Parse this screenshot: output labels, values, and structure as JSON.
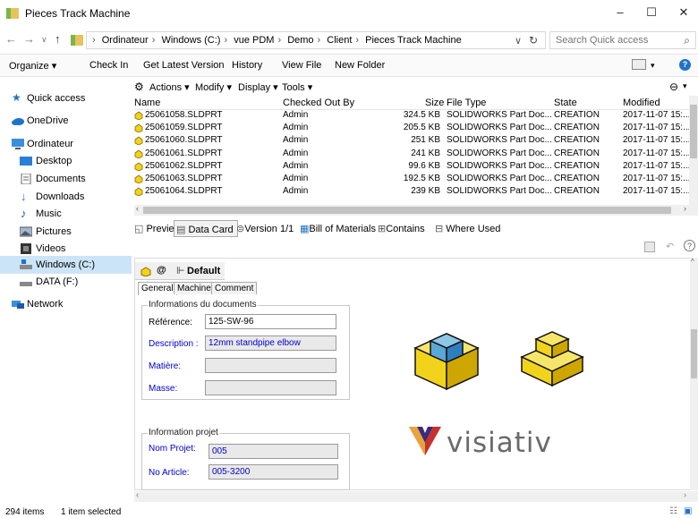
{
  "window": {
    "title": "Pieces Track Machine",
    "minimize": "–",
    "maximize": "☐",
    "close": "✕"
  },
  "address": {
    "crumbs": [
      "Ordinateur",
      "Windows (C:)",
      "vue PDM",
      "Demo",
      "Client",
      "Pieces Track Machine"
    ],
    "search_placeholder": "Search Quick access"
  },
  "commands": [
    "Organize ▾",
    "Check In",
    "Get Latest Version",
    "History",
    "View File",
    "New Folder"
  ],
  "nav": [
    {
      "label": "Quick access",
      "icon": "star-icon"
    },
    {
      "label": "OneDrive",
      "icon": "cloud-icon"
    },
    {
      "label": "Ordinateur",
      "icon": "computer-icon"
    },
    {
      "label": "Desktop",
      "icon": "desktop-icon"
    },
    {
      "label": "Documents",
      "icon": "documents-icon"
    },
    {
      "label": "Downloads",
      "icon": "download-icon"
    },
    {
      "label": "Music",
      "icon": "music-icon"
    },
    {
      "label": "Pictures",
      "icon": "pictures-icon"
    },
    {
      "label": "Videos",
      "icon": "videos-icon"
    },
    {
      "label": "Windows (C:)",
      "icon": "drive-icon"
    },
    {
      "label": "DATA (F:)",
      "icon": "drive-icon"
    },
    {
      "label": "Network",
      "icon": "network-icon"
    }
  ],
  "pdm_menu": [
    "Actions ▾",
    "Modify ▾",
    "Display ▾",
    "Tools ▾"
  ],
  "columns": [
    "Name",
    "Checked Out By",
    "Size",
    "File Type",
    "State",
    "Modified"
  ],
  "files": [
    {
      "name": "25061058.SLDPRT",
      "by": "Admin",
      "size": "324.5 KB",
      "type": "SOLIDWORKS Part Doc...",
      "state": "CREATION",
      "modified": "2017-11-07 15:..."
    },
    {
      "name": "25061059.SLDPRT",
      "by": "Admin",
      "size": "205.5 KB",
      "type": "SOLIDWORKS Part Doc...",
      "state": "CREATION",
      "modified": "2017-11-07 15:..."
    },
    {
      "name": "25061060.SLDPRT",
      "by": "Admin",
      "size": "251 KB",
      "type": "SOLIDWORKS Part Doc...",
      "state": "CREATION",
      "modified": "2017-11-07 15:..."
    },
    {
      "name": "25061061.SLDPRT",
      "by": "Admin",
      "size": "241 KB",
      "type": "SOLIDWORKS Part Doc...",
      "state": "CREATION",
      "modified": "2017-11-07 15:..."
    },
    {
      "name": "25061062.SLDPRT",
      "by": "Admin",
      "size": "99.6 KB",
      "type": "SOLIDWORKS Part Doc...",
      "state": "CREATION",
      "modified": "2017-11-07 15:..."
    },
    {
      "name": "25061063.SLDPRT",
      "by": "Admin",
      "size": "192.5 KB",
      "type": "SOLIDWORKS Part Doc...",
      "state": "CREATION",
      "modified": "2017-11-07 15:..."
    },
    {
      "name": "25061064.SLDPRT",
      "by": "Admin",
      "size": "239 KB",
      "type": "SOLIDWORKS Part Doc...",
      "state": "CREATION",
      "modified": "2017-11-07 15:..."
    }
  ],
  "tabs": [
    "Preview",
    "Data Card",
    "Version 1/1",
    "Bill of Materials",
    "Contains",
    "Where Used"
  ],
  "card": {
    "symbol": "@",
    "config": "Default",
    "tabs": [
      "General",
      "Machine",
      "Comment"
    ],
    "group_doc": "Informations du documents",
    "ref_label": "Référence:",
    "ref_value": "125-SW-96",
    "desc_label": "Description :",
    "desc_value": "12mm standpipe elbow",
    "mat_label": "Matière:",
    "mass_label": "Masse:",
    "group_proj": "Information projet",
    "proj_label": "Nom Projet:",
    "proj_value": "005",
    "art_label": "No Article:",
    "art_value": "005-3200",
    "logo_text": "visiativ"
  },
  "status": {
    "count": "294 items",
    "selected": "1 item selected"
  },
  "colors": {
    "selection": "#cce4f7",
    "accent_blue": "#0000cc",
    "part_yellow": "#f2d31b"
  }
}
